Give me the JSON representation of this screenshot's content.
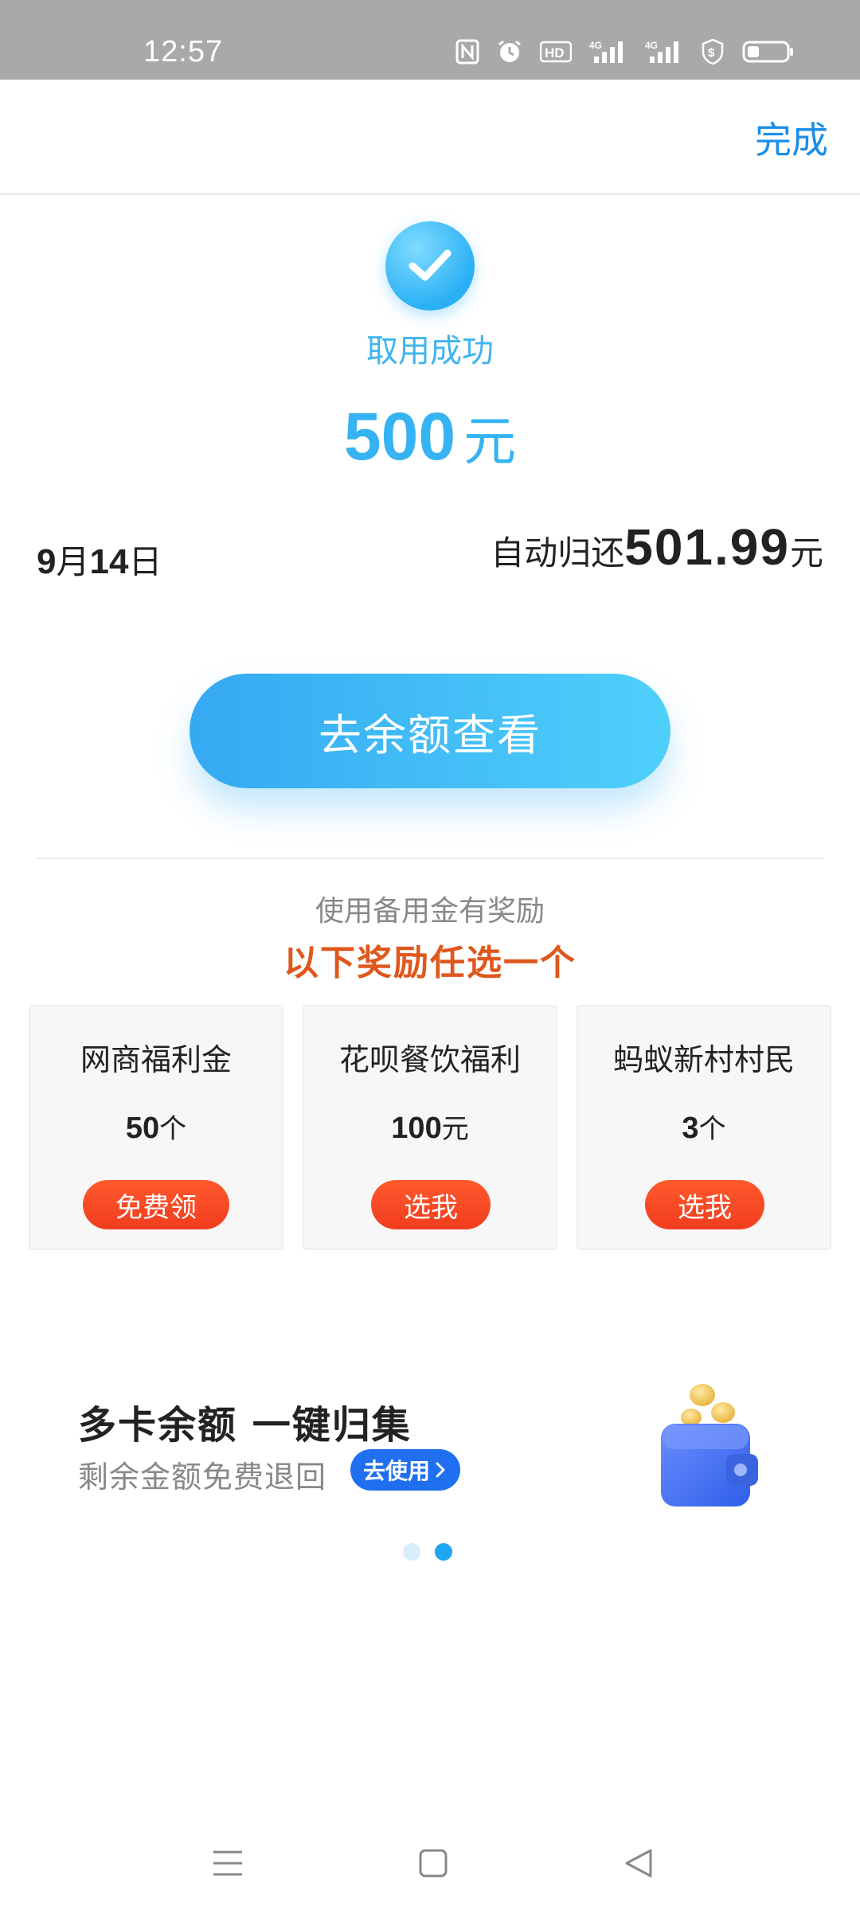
{
  "status_bar": {
    "time": "12:57",
    "icons": [
      "nfc-icon",
      "alarm-icon",
      "hd-voice-icon",
      "signal-4g-icon",
      "signal-4g-icon",
      "payment-shield-icon",
      "battery-icon"
    ]
  },
  "header": {
    "done_label": "完成"
  },
  "result": {
    "status_text": "取用成功",
    "amount": "500",
    "amount_unit": "元"
  },
  "repay": {
    "date_month": "9",
    "date_month_unit": "月",
    "date_day": "14",
    "date_day_unit": "日",
    "label": "自动归还",
    "value": "501.99",
    "unit": "元"
  },
  "main_button": {
    "label": "去余额查看"
  },
  "rewards": {
    "subtitle": "使用备用金有奖励",
    "title": "以下奖励任选一个",
    "items": [
      {
        "title": "网商福利金",
        "value": "50",
        "unit": "个",
        "button": "免费领"
      },
      {
        "title": "花呗餐饮福利",
        "value": "100",
        "unit": "元",
        "button": "选我"
      },
      {
        "title": "蚂蚁新村村民",
        "value": "3",
        "unit": "个",
        "button": "选我"
      }
    ]
  },
  "promo": {
    "title": "多卡余额 一键归集",
    "subtitle": "剩余金额免费退回",
    "button": "去使用",
    "active_slide": 2,
    "total_slides": 2
  },
  "colors": {
    "accent_blue": "#35b3f3",
    "reward_orange": "#e0571e",
    "card_button_red": "#f13d1e",
    "promo_button_blue": "#1f6ff0",
    "done_blue": "#1a8ee8"
  }
}
